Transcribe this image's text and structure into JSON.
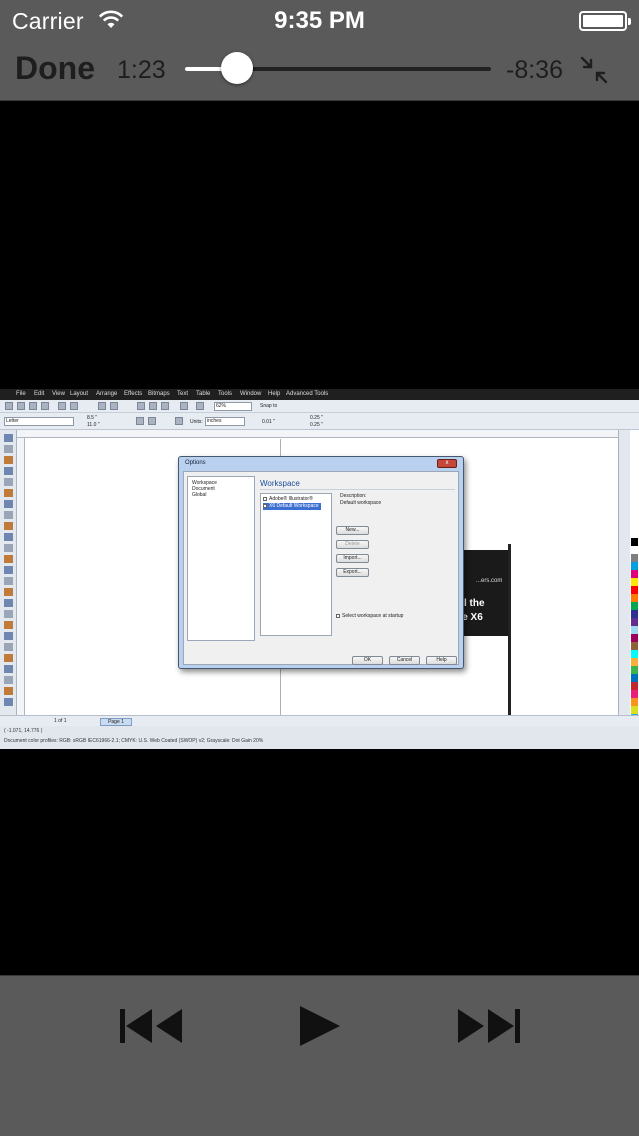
{
  "status_bar": {
    "carrier": "Carrier",
    "time": "9:35 PM",
    "battery_level": 1.0
  },
  "player": {
    "done_label": "Done",
    "elapsed": "1:23",
    "remaining": "-8:36",
    "progress": 0.17,
    "icons": {
      "exit_fullscreen": "exit-fullscreen-icon",
      "previous": "skip-back-icon",
      "play": "play-icon",
      "next": "skip-forward-icon"
    }
  },
  "video_frame": {
    "menu": [
      "File",
      "Edit",
      "View",
      "Layout",
      "Arrange",
      "Effects",
      "Bitmaps",
      "Text",
      "Table",
      "Tools",
      "Window",
      "Help",
      "Advanced Tools"
    ],
    "zoom": "62%",
    "snap_to": "Snap to",
    "page_size": "Letter",
    "width": "8.5 \"",
    "height": "11.0 \"",
    "units_label": "Units:",
    "units": "inches",
    "nudge": "0.01 \"",
    "dup_x": "0.25 \"",
    "dup_y": "0.25 \"",
    "page_nav": "1 of 1",
    "page_tab": "Page 1",
    "coords": "( -1.071, 14.776 )",
    "color_profiles": "Document color profiles: RGB: sRGB IEC61966-2.1; CMYK: U.S. Web Coated (SWOP) v2; Grayscale: Dot Gain 20%",
    "promo": {
      "url": "...ers.com",
      "line1": "l the",
      "line2": "uite X6"
    },
    "dialog": {
      "title": "Options",
      "close": "x",
      "tree": [
        "Workspace",
        "Document",
        "Global"
      ],
      "heading": "Workspace",
      "workspaces": [
        {
          "label": "Adobe® Illustrator®",
          "checked": false,
          "selected": false
        },
        {
          "label": "X6 Default Workspace",
          "checked": true,
          "selected": true
        }
      ],
      "description_label": "Description:",
      "description": "Default workspace",
      "buttons": [
        "New...",
        "Delete",
        "Import...",
        "Export..."
      ],
      "startup_label": "Select workspace at startup",
      "ok": "OK",
      "cancel": "Cancel",
      "help": "Help"
    },
    "palette_colors": [
      "#000000",
      "#ffffff",
      "#7f7f7f",
      "#00a0e0",
      "#e0007a",
      "#ffe600",
      "#ff0000",
      "#ff7a00",
      "#00a650",
      "#2e3192",
      "#662d91",
      "#a0d8ef",
      "#9e005d",
      "#8c6239",
      "#00ffff",
      "#fbb03b",
      "#39b54a",
      "#0071bc",
      "#c1272d",
      "#ed1e79",
      "#f7931e",
      "#d9e021",
      "#29abe2"
    ]
  },
  "colors": {
    "bar_bg": "#5a5a5a",
    "text_dark": "#1e1e1e",
    "video_bg": "#000000"
  }
}
